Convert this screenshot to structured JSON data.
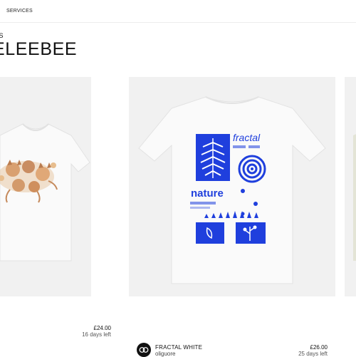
{
  "nav": {
    "services_label": "SERVICES"
  },
  "header": {
    "breadcrumb": "RS",
    "title": "ELEEBEE"
  },
  "products": [
    {
      "price": "£24.00",
      "time_left": "16 days left"
    },
    {
      "title": "FRACTAL WHITE",
      "author": "oliguore",
      "price": "£26.00",
      "time_left": "25 days left",
      "print_words": {
        "top": "fractal",
        "middle": "nature"
      },
      "avatar_initials": "oq"
    }
  ],
  "colors": {
    "print_blue": "#1f3fdd",
    "card_bg": "#f1f1f1",
    "shirt_white": "#fafafa"
  }
}
